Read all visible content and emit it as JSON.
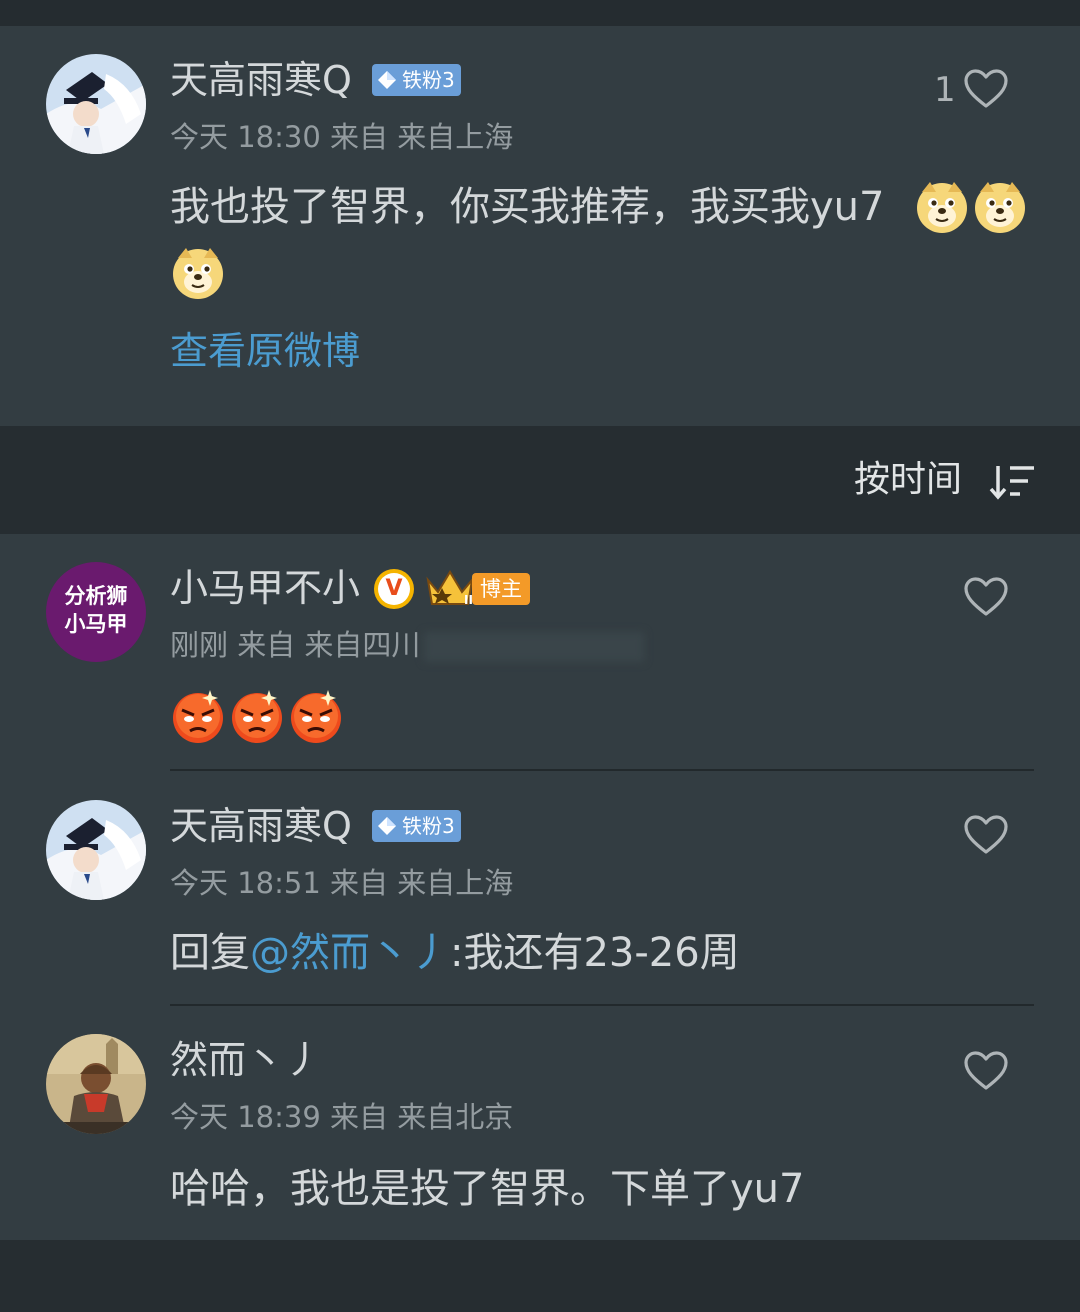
{
  "main_comment": {
    "username": "天高雨寒Q",
    "fan_badge": "铁粉3",
    "meta": "今天 18:30 来自 来自上海",
    "like_count": "1",
    "text": "我也投了智界，你买我推荐，我买我yu7",
    "emoji_name": "doge",
    "view_original": "查看原微博"
  },
  "sort": {
    "label": "按时间",
    "icon": "sort-descending-icon"
  },
  "replies": [
    {
      "username": "小马甲不小",
      "avatar_text_line1": "分析狮",
      "avatar_text_line2": "小马甲",
      "verified_letter": "V",
      "blogger_badge": "博主",
      "crown_level": "II",
      "meta": "刚刚 来自 来自四川",
      "emoji_name": "angry-face"
    },
    {
      "username": "天高雨寒Q",
      "fan_badge": "铁粉3",
      "meta": "今天 18:51 来自 来自上海",
      "reply_prefix": "回复",
      "mention": "@然而丶丿",
      "text": ":我还有23-26周"
    },
    {
      "username": "然而丶丿",
      "meta": "今天 18:39 来自 来自北京",
      "text": "哈哈，我也是投了智界。下单了yu7"
    }
  ],
  "colors": {
    "background": "#2b3236",
    "card": "#333d42",
    "link": "#4b9cd0",
    "fan_badge": "#6a9ed8",
    "blogger_badge": "#f39a28",
    "verified": "#f5b400"
  }
}
